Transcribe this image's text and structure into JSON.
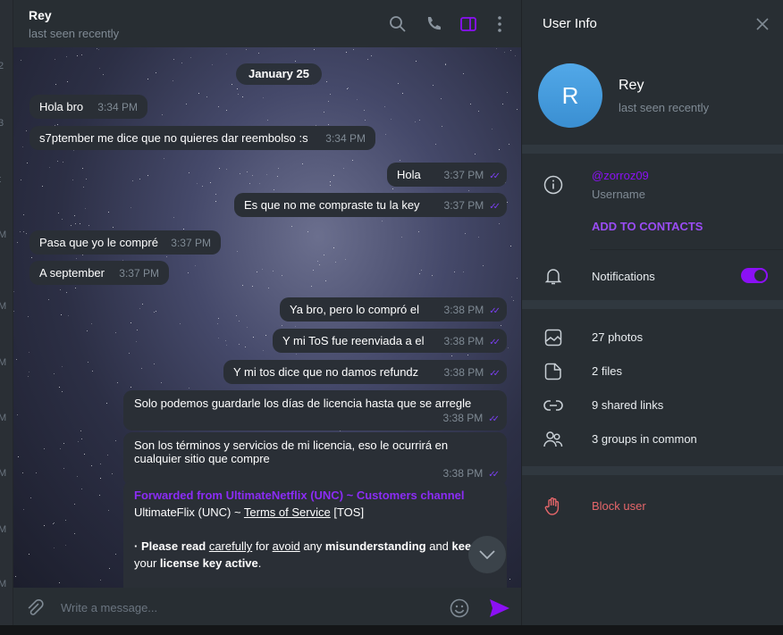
{
  "chat": {
    "title": "Rey",
    "status": "last seen recently",
    "date": "January 25",
    "messages": [
      {
        "dir": "in",
        "text": "Hola bro",
        "time": "3:34 PM"
      },
      {
        "dir": "in",
        "text": "s7ptember me dice que no quieres dar reembolso :s",
        "time": "3:34 PM"
      },
      {
        "dir": "out",
        "text": "Hola",
        "time": "3:37 PM"
      },
      {
        "dir": "out",
        "text": "Es que no me compraste tu la key",
        "time": "3:37 PM"
      },
      {
        "dir": "in",
        "text": "Pasa que yo le compré",
        "time": "3:37 PM"
      },
      {
        "dir": "in",
        "text": "A september",
        "time": "3:37 PM"
      },
      {
        "dir": "out",
        "text": "Ya bro, pero lo compró el",
        "time": "3:38 PM"
      },
      {
        "dir": "out",
        "text": "Y mi ToS fue reenviada a el",
        "time": "3:38 PM"
      },
      {
        "dir": "out",
        "text": "Y mi tos dice que no damos refundz",
        "time": "3:38 PM"
      },
      {
        "dir": "out",
        "text": "Solo podemos guardarle los días de licencia hasta que se arregle",
        "time": "3:38 PM"
      },
      {
        "dir": "out",
        "text": "Son los términos y servicios de mi licencia, eso le ocurrirá en cualquier sitio que compre",
        "time": "3:38 PM"
      }
    ],
    "forwarded": {
      "from": "Forwarded from UltimateNetflix (UNC) ~ Customers channel",
      "line1_a": "UltimateFlix (UNC) ~ ",
      "line1_link": "Terms of Service",
      "line1_b": " [TOS]",
      "p_a": "· Please read ",
      "p_b": "carefully",
      "p_c": " for ",
      "p_d": "avoid",
      "p_e": " any ",
      "p_f": "misunderstanding",
      "p_g": " and ",
      "p_h": "keep",
      "p_i": " your ",
      "p_j": "license key active",
      "p_k": "."
    },
    "input_placeholder": "Write a message...",
    "left_strip": [
      "2",
      "3",
      "t",
      "M",
      "M",
      "M",
      "M",
      "M",
      "M",
      "M"
    ]
  },
  "panel": {
    "title": "User Info",
    "avatar_letter": "R",
    "name": "Rey",
    "status": "last seen recently",
    "username": "@zorroz09",
    "username_label": "Username",
    "add_contacts": "ADD TO CONTACTS",
    "notifications": "Notifications",
    "notifications_on": true,
    "media": [
      "27 photos",
      "2 files",
      "9 shared links",
      "3 groups in common"
    ],
    "block": "Block user"
  },
  "colors": {
    "accent": "#8b10f5",
    "danger": "#e5666a",
    "avatar": "#4a9fe0"
  }
}
